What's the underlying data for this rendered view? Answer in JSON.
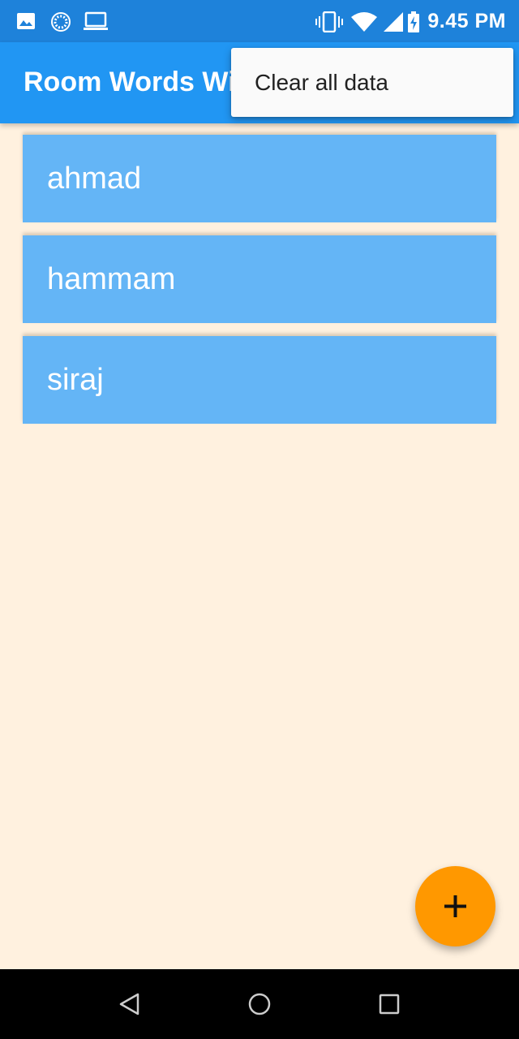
{
  "status_bar": {
    "time": "9.45 PM",
    "icons": [
      "image-icon",
      "sync-icon",
      "laptop-icon",
      "vibrate-icon",
      "wifi-icon",
      "signal-icon",
      "battery-charging-icon"
    ]
  },
  "app_bar": {
    "title": "Room Words With"
  },
  "menu": {
    "items": [
      {
        "label": "Clear all data"
      }
    ]
  },
  "words": [
    {
      "text": "ahmad"
    },
    {
      "text": "hammam"
    },
    {
      "text": "siraj"
    }
  ],
  "fab": {
    "icon": "plus-icon"
  },
  "nav_bar": {
    "icons": [
      "back-icon",
      "home-icon",
      "recents-icon"
    ]
  },
  "colors": {
    "status_bar": "#1E82DA",
    "app_bar": "#2196F3",
    "background": "#FFF1DF",
    "card": "#64B5F6",
    "fab": "#FF9800",
    "menu": "#FAFAFA",
    "nav_bar": "#000000"
  }
}
